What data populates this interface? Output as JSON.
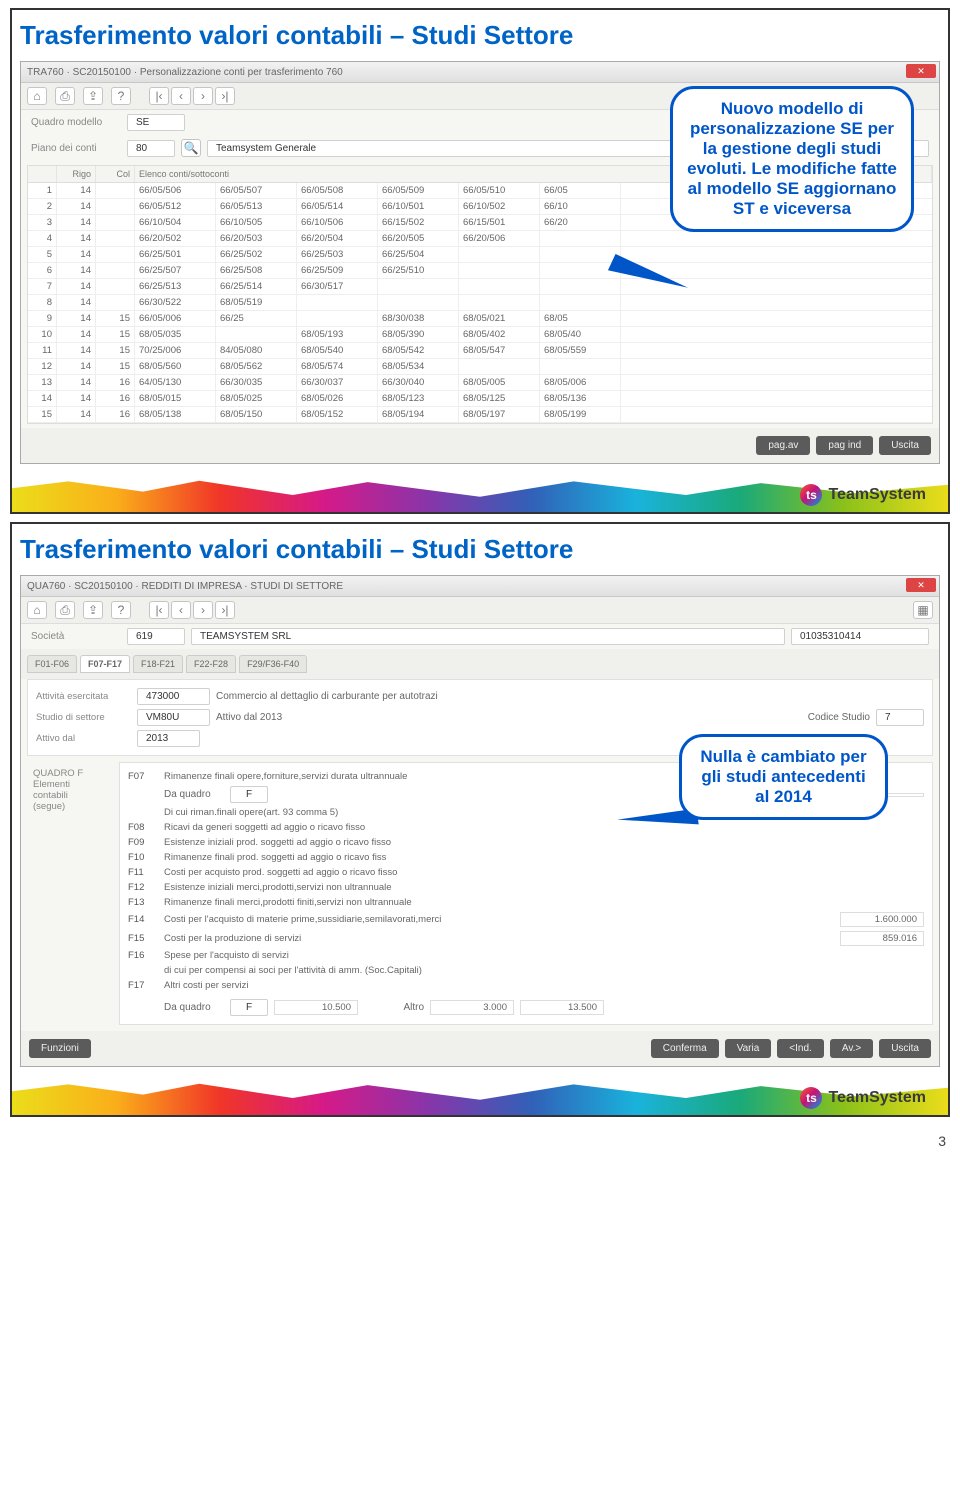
{
  "slide_title": "Trasferimento valori contabili – Studi Settore",
  "page_number": "3",
  "callout1": "Nuovo modello di personalizzazione SE per la gestione degli studi evoluti. Le modifiche fatte al modello SE aggiornano ST e viceversa",
  "callout2": "Nulla è cambiato per gli studi antecedenti al 2014",
  "logo_text": "TeamSystem",
  "app1": {
    "titlebar": "TRA760 · SC20150100 · Personalizzazione conti per trasferimento 760",
    "quadro_label": "Quadro modello",
    "quadro_value": "SE",
    "piano_label": "Piano dei conti",
    "piano_code": "80",
    "piano_desc": "Teamsystem Generale",
    "grid_headers": [
      "",
      "Rigo",
      "Col",
      "Elenco conti/sottoconti"
    ],
    "rows": [
      {
        "idx": "1",
        "r": "14",
        "col": "",
        "codes": [
          "66/05/506",
          "66/05/507",
          "66/05/508",
          "66/05/509",
          "66/05/510",
          "66/05"
        ]
      },
      {
        "idx": "2",
        "r": "14",
        "col": "",
        "codes": [
          "66/05/512",
          "66/05/513",
          "66/05/514",
          "66/10/501",
          "66/10/502",
          "66/10"
        ]
      },
      {
        "idx": "3",
        "r": "14",
        "col": "",
        "codes": [
          "66/10/504",
          "66/10/505",
          "66/10/506",
          "66/15/502",
          "66/15/501",
          "66/20"
        ]
      },
      {
        "idx": "4",
        "r": "14",
        "col": "",
        "codes": [
          "66/20/502",
          "66/20/503",
          "66/20/504",
          "66/20/505",
          "66/20/506",
          ""
        ]
      },
      {
        "idx": "5",
        "r": "14",
        "col": "",
        "codes": [
          "66/25/501",
          "66/25/502",
          "66/25/503",
          "66/25/504",
          "",
          "  "
        ]
      },
      {
        "idx": "6",
        "r": "14",
        "col": "",
        "codes": [
          "66/25/507",
          "66/25/508",
          "66/25/509",
          "66/25/510",
          "",
          ""
        ]
      },
      {
        "idx": "7",
        "r": "14",
        "col": "",
        "codes": [
          "66/25/513",
          "66/25/514",
          "66/30/517",
          "",
          "",
          ""
        ]
      },
      {
        "idx": "8",
        "r": "14",
        "col": "",
        "codes": [
          "66/30/522",
          "68/05/519",
          "",
          "",
          "",
          ""
        ]
      },
      {
        "idx": "9",
        "r": "14",
        "col": "15",
        "codes": [
          "66/05/006",
          "66/25",
          "",
          "68/30/038",
          "68/05/021",
          "68/05"
        ]
      },
      {
        "idx": "10",
        "r": "14",
        "col": "15",
        "codes": [
          "68/05/035",
          "",
          "68/05/193",
          "68/05/390",
          "68/05/402",
          "68/05/40"
        ]
      },
      {
        "idx": "11",
        "r": "14",
        "col": "15",
        "codes": [
          "70/25/006",
          "84/05/080",
          "68/05/540",
          "68/05/542",
          "68/05/547",
          "68/05/559"
        ]
      },
      {
        "idx": "12",
        "r": "14",
        "col": "15",
        "codes": [
          "68/05/560",
          "68/05/562",
          "68/05/574",
          "68/05/534",
          "",
          ""
        ]
      },
      {
        "idx": "13",
        "r": "14",
        "col": "16",
        "codes": [
          "64/05/130",
          "66/30/035",
          "66/30/037",
          "66/30/040",
          "68/05/005",
          "68/05/006"
        ]
      },
      {
        "idx": "14",
        "r": "14",
        "col": "16",
        "codes": [
          "68/05/015",
          "68/05/025",
          "68/05/026",
          "68/05/123",
          "68/05/125",
          "68/05/136"
        ]
      },
      {
        "idx": "15",
        "r": "14",
        "col": "16",
        "codes": [
          "68/05/138",
          "68/05/150",
          "68/05/152",
          "68/05/194",
          "68/05/197",
          "68/05/199"
        ]
      }
    ],
    "btn_pagav": "pag.av",
    "btn_pagind": "pag ind",
    "btn_uscita": "Uscita"
  },
  "app2": {
    "titlebar": "QUA760 · SC20150100 · REDDITI DI IMPRESA · STUDI DI SETTORE",
    "soc_label": "Società",
    "soc_code": "619",
    "soc_name": "TEAMSYSTEM SRL",
    "soc_pi": "01035310414",
    "tabs": [
      "F01-F06",
      "F07-F17",
      "F18-F21",
      "F22-F28",
      "F29/F36-F40"
    ],
    "att_label": "Attività esercitata",
    "att_code": "473000",
    "att_desc": "Commercio al dettaglio di carburante per autotrazi",
    "studio_label": "Studio di settore",
    "studio_code": "VM80U",
    "studio_desc": "Attivo dal 2013",
    "cod_studio_label": "Codice Studio",
    "cod_studio_val": "7",
    "attivo_label": "Attivo dal",
    "attivo_val": "2013",
    "section_labels": [
      "QUADRO F",
      "Elementi",
      "contabili",
      "(segue)"
    ],
    "daquadro": "Da quadro",
    "altro": "Altro",
    "lines": [
      {
        "code": "F07",
        "desc": "Rimanenze finali opere,forniture,servizi durata ultrannuale",
        "v": ""
      },
      {
        "code": "",
        "desc": "Di cui riman.finali opere(art. 93 comma 5)",
        "v": ""
      },
      {
        "code": "F08",
        "desc": "Ricavi da generi soggetti ad aggio o ricavo fisso",
        "v": ""
      },
      {
        "code": "F09",
        "desc": "Esistenze iniziali prod. soggetti ad aggio o ricavo fisso",
        "v": ""
      },
      {
        "code": "F10",
        "desc": "Rimanenze finali prod. soggetti ad aggio o ricavo fiss",
        "v": ""
      },
      {
        "code": "F11",
        "desc": "Costi per acquisto prod. soggetti ad aggio o ricavo fisso",
        "v": ""
      },
      {
        "code": "F12",
        "desc": "Esistenze iniziali merci,prodotti,servizi non ultrannuale",
        "v": ""
      },
      {
        "code": "F13",
        "desc": "Rimanenze finali merci,prodotti finiti,servizi non ultrannuale",
        "v": ""
      },
      {
        "code": "F14",
        "desc": "Costi per l'acquisto di materie prime,sussidiarie,semilavorati,merci",
        "v": "1.600.000"
      },
      {
        "code": "F15",
        "desc": "Costi per la produzione di servizi",
        "v": "859.016"
      },
      {
        "code": "F16",
        "desc": "Spese per l'acquisto di servizi",
        "v": ""
      },
      {
        "code": "",
        "desc": "di cui per compensi ai soci per l'attività di amm. (Soc.Capitali)",
        "v": ""
      },
      {
        "code": "F17",
        "desc": "Altri costi per servizi",
        "v": ""
      }
    ],
    "bottom_daq_val": "F",
    "bottom_v1": "10.500",
    "bottom_altro": "3.000",
    "bottom_sum": "13.500",
    "btn_funz": "Funzioni",
    "btn_conf": "Conferma",
    "btn_varia": "Varia",
    "btn_ind": "<Ind.",
    "btn_av": "Av.>",
    "btn_usc": "Uscita"
  }
}
